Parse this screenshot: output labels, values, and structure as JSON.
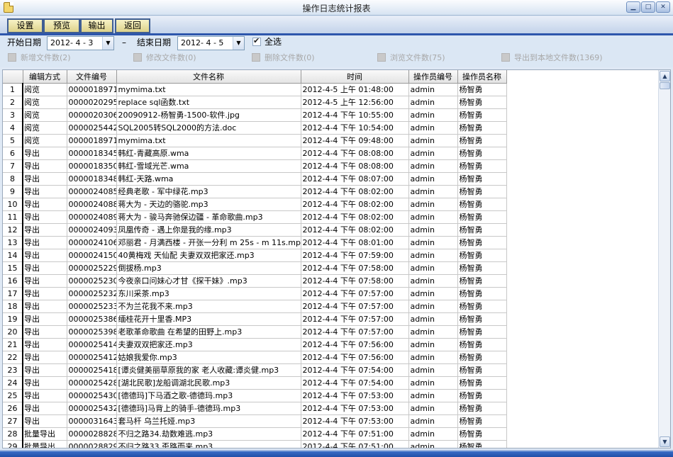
{
  "window": {
    "title": "操作日志统计报表"
  },
  "toolbar": {
    "buttons": [
      "设置",
      "预览",
      "输出",
      "返回"
    ]
  },
  "filter": {
    "start_label": "开始日期",
    "start_value": "2012- 4 - 3",
    "dash": "–",
    "end_label": "结束日期",
    "end_value": "2012- 4 - 5",
    "select_all": "全选",
    "options": [
      "新增文件数(2)",
      "修改文件数(0)",
      "删除文件数(0)",
      "浏览文件数(75)",
      "导出到本地文件数(1369)"
    ]
  },
  "table": {
    "columns": [
      "",
      "编辑方式",
      "文件编号",
      "文件名称",
      "时间",
      "操作员编号",
      "操作员名称"
    ],
    "rows": [
      [
        "1",
        "阅览",
        "0000018971",
        "mymima.txt",
        "2012-4-5 上午 01:48:00",
        "admin",
        "杨智勇"
      ],
      [
        "2",
        "阅览",
        "0000020295",
        "replace sql函数.txt",
        "2012-4-5 上午 12:56:00",
        "admin",
        "杨智勇"
      ],
      [
        "3",
        "阅览",
        "0000020306",
        "20090912-杨智勇-1500-软件.jpg",
        "2012-4-4 下午 10:55:00",
        "admin",
        "杨智勇"
      ],
      [
        "4",
        "阅览",
        "0000025442",
        "SQL2005转SQL2000的方法.doc",
        "2012-4-4 下午 10:54:00",
        "admin",
        "杨智勇"
      ],
      [
        "5",
        "阅览",
        "0000018971",
        "mymima.txt",
        "2012-4-4 下午 09:48:00",
        "admin",
        "杨智勇"
      ],
      [
        "6",
        "导出",
        "0000018345",
        "韩红-青藏高原.wma",
        "2012-4-4 下午 08:08:00",
        "admin",
        "杨智勇"
      ],
      [
        "7",
        "导出",
        "0000018350",
        "韩红-雪域光芒.wma",
        "2012-4-4 下午 08:08:00",
        "admin",
        "杨智勇"
      ],
      [
        "8",
        "导出",
        "0000018348",
        "韩红-天路.wma",
        "2012-4-4 下午 08:07:00",
        "admin",
        "杨智勇"
      ],
      [
        "9",
        "导出",
        "0000024085",
        "经典老歌 - 军中绿花.mp3",
        "2012-4-4 下午 08:02:00",
        "admin",
        "杨智勇"
      ],
      [
        "10",
        "导出",
        "0000024088",
        "蒋大为 - 天边的骆驼.mp3",
        "2012-4-4 下午 08:02:00",
        "admin",
        "杨智勇"
      ],
      [
        "11",
        "导出",
        "0000024089",
        "蒋大为 - 骏马奔驰保边疆 - 革命歌曲.mp3",
        "2012-4-4 下午 08:02:00",
        "admin",
        "杨智勇"
      ],
      [
        "12",
        "导出",
        "0000024093",
        "凤凰传奇 - 遇上你是我的缘.mp3",
        "2012-4-4 下午 08:02:00",
        "admin",
        "杨智勇"
      ],
      [
        "13",
        "导出",
        "0000024106",
        "邓丽君 - 月满西楼 - 开张一分利 m 25s - m 11s.mp3",
        "2012-4-4 下午 08:01:00",
        "admin",
        "杨智勇"
      ],
      [
        "14",
        "导出",
        "0000024150",
        "40黄梅戏 天仙配 夫妻双双把家还.mp3",
        "2012-4-4 下午 07:59:00",
        "admin",
        "杨智勇"
      ],
      [
        "15",
        "导出",
        "0000025229",
        "倒拔杨.mp3",
        "2012-4-4 下午 07:58:00",
        "admin",
        "杨智勇"
      ],
      [
        "16",
        "导出",
        "0000025230",
        "今夜亲口问妹心才甘《探干妹》.mp3",
        "2012-4-4 下午 07:58:00",
        "admin",
        "杨智勇"
      ],
      [
        "17",
        "导出",
        "0000025232",
        "东川采茶.mp3",
        "2012-4-4 下午 07:57:00",
        "admin",
        "杨智勇"
      ],
      [
        "18",
        "导出",
        "0000025233",
        "不为兰花我不来.mp3",
        "2012-4-4 下午 07:57:00",
        "admin",
        "杨智勇"
      ],
      [
        "19",
        "导出",
        "0000025386",
        "缅桂花开十里香.MP3",
        "2012-4-4 下午 07:57:00",
        "admin",
        "杨智勇"
      ],
      [
        "20",
        "导出",
        "0000025398",
        "老歌革命歌曲 在希望的田野上.mp3",
        "2012-4-4 下午 07:57:00",
        "admin",
        "杨智勇"
      ],
      [
        "21",
        "导出",
        "0000025414",
        "夫妻双双把家还.mp3",
        "2012-4-4 下午 07:56:00",
        "admin",
        "杨智勇"
      ],
      [
        "22",
        "导出",
        "0000025412",
        "姑娘我爱你.mp3",
        "2012-4-4 下午 07:56:00",
        "admin",
        "杨智勇"
      ],
      [
        "23",
        "导出",
        "0000025418",
        "[谭炎健美丽草原我的家 老人收藏:谭炎健.mp3",
        "2012-4-4 下午 07:54:00",
        "admin",
        "杨智勇"
      ],
      [
        "24",
        "导出",
        "0000025428",
        "[湖北民歌]龙船调湖北民歌.mp3",
        "2012-4-4 下午 07:54:00",
        "admin",
        "杨智勇"
      ],
      [
        "25",
        "导出",
        "0000025430",
        "[德德玛]下马酒之歌-德德玛.mp3",
        "2012-4-4 下午 07:53:00",
        "admin",
        "杨智勇"
      ],
      [
        "26",
        "导出",
        "0000025432",
        "[德德玛]马背上的骑手-德德玛.mp3",
        "2012-4-4 下午 07:53:00",
        "admin",
        "杨智勇"
      ],
      [
        "27",
        "导出",
        "0000031643",
        "套马杆 乌兰托娅.mp3",
        "2012-4-4 下午 07:53:00",
        "admin",
        "杨智勇"
      ],
      [
        "28",
        "批量导出",
        "0000028828",
        "不归之路34.劫数难逃.mp3",
        "2012-4-4 下午 07:51:00",
        "admin",
        "杨智勇"
      ],
      [
        "29",
        "批量导出",
        "0000028829",
        "不归之路33.歪路而来.mp3",
        "2012-4-4 下午 07:51:00",
        "admin",
        "杨智勇"
      ]
    ]
  }
}
